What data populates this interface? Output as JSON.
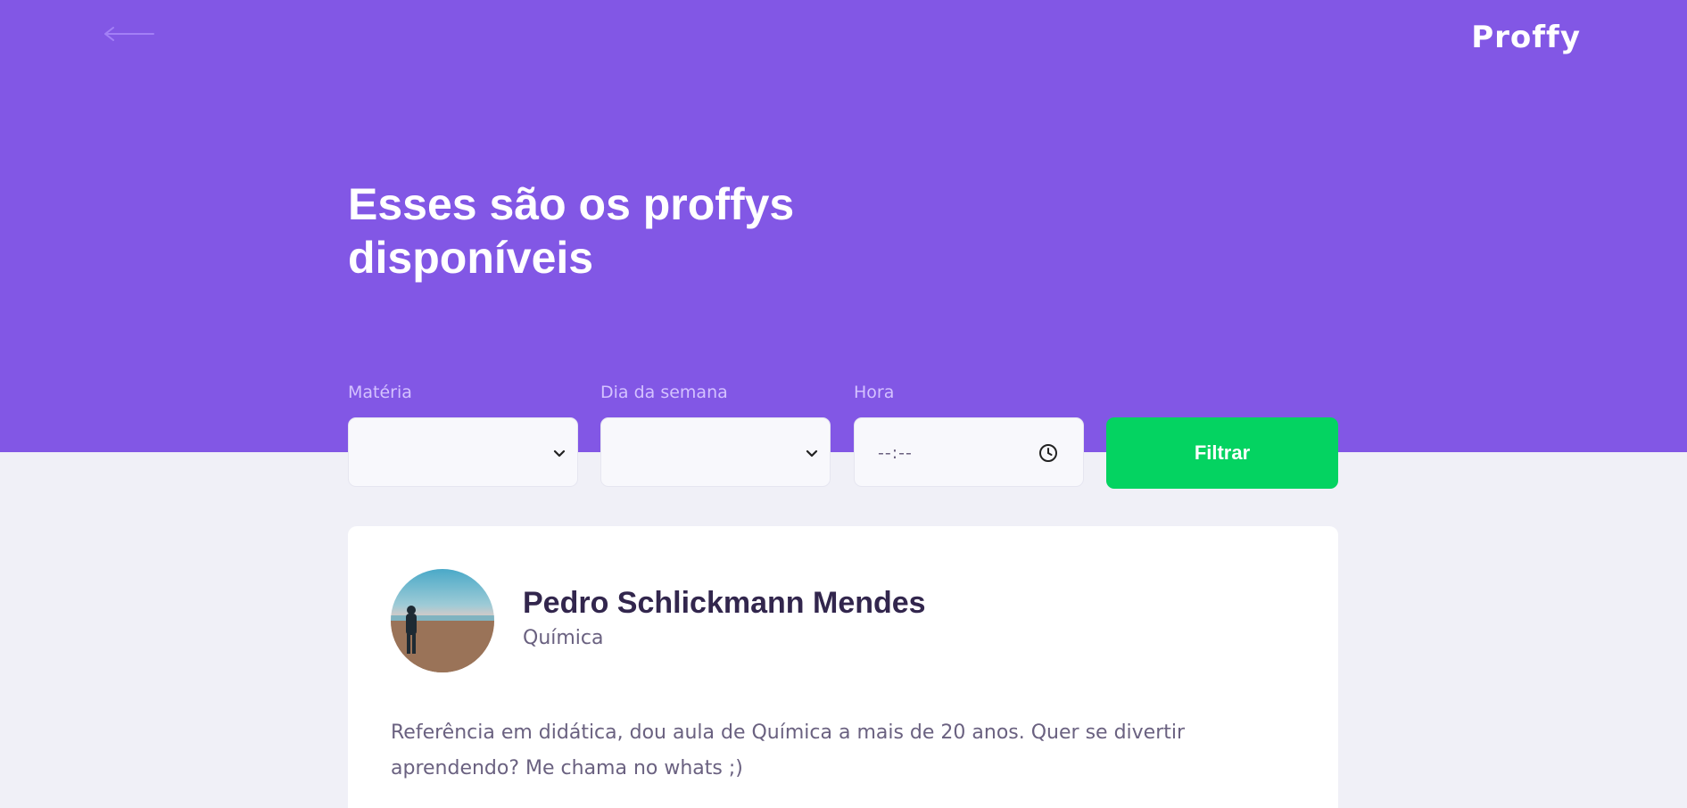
{
  "header": {
    "back_icon": "arrow-left-icon",
    "logo": "Proffy",
    "title": "Esses são os proffys disponíveis"
  },
  "filters": {
    "subject": {
      "label": "Matéria",
      "value": "",
      "icon": "chevron-down-icon"
    },
    "weekday": {
      "label": "Dia da semana",
      "value": "",
      "icon": "chevron-down-icon"
    },
    "time": {
      "label": "Hora",
      "value": "--:--",
      "icon": "clock-icon"
    },
    "submit_label": "Filtrar"
  },
  "teacher": {
    "name": "Pedro Schlickmann Mendes",
    "subject": "Química",
    "bio": "Referência em didática, dou aula de Química a mais de 20 anos. Quer se divertir aprendendo? Me chama no whats ;)"
  },
  "colors": {
    "primary": "#8257e5",
    "accent_green": "#04d361",
    "background": "#f0f0f7",
    "title_text": "#32264d",
    "body_text": "#6a6180"
  }
}
